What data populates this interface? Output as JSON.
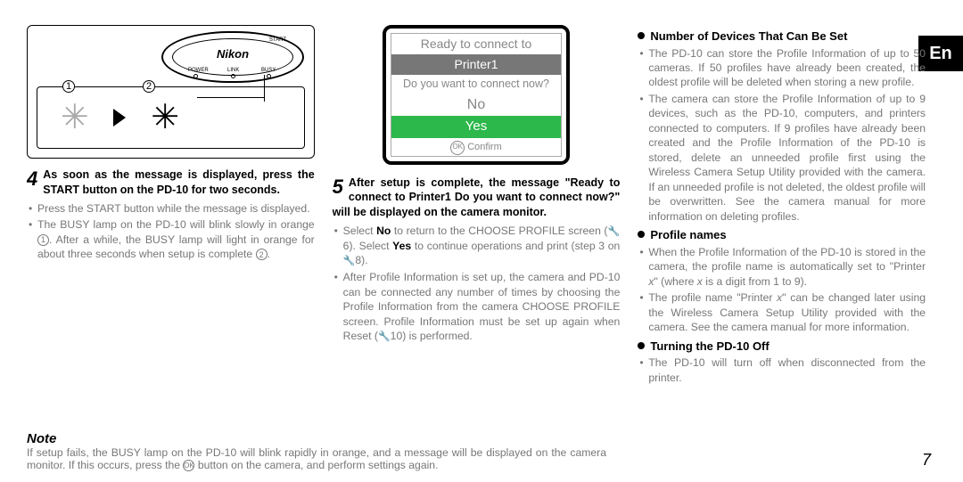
{
  "lang_tab": "En",
  "page_number": "7",
  "illustration": {
    "brand": "Nikon",
    "label_power": "POWER",
    "label_link": "LINK",
    "label_busy": "BUSY",
    "label_start": "START",
    "callout1": "1",
    "callout2": "2"
  },
  "step4": {
    "num": "4",
    "head": "As soon as the message is displayed, press the START button on the PD-10 for two seconds.",
    "b1": "Press the START button while the message is displayed.",
    "b2a": "The BUSY lamp on the PD-10 will blink slowly in orange ",
    "b2b": ". After a while, the BUSY lamp will light in orange for about three seconds when setup is complete ",
    "b2c": "."
  },
  "note": {
    "title": "Note",
    "body_a": "If setup fails, the BUSY lamp on the PD-10 will blink rapidly in orange, and a message will be displayed on the camera monitor. If this occurs, press the ",
    "body_b": " button on the camera, and perform settings again."
  },
  "dialog": {
    "l1": "Ready to connect to",
    "l2": "Printer1",
    "l3": "Do you want to connect now?",
    "l4": "No",
    "l5": "Yes",
    "confirm": "Confirm",
    "ok": "OK"
  },
  "step5": {
    "num": "5",
    "head": "After setup is complete, the message \"Ready to connect to Printer1 Do you want to connect now?\" will be displayed on the camera monitor.",
    "b1a": "Select ",
    "b1b": "No",
    "b1c": " to return to the CHOOSE PROFILE screen (",
    "b1d": "6). Select ",
    "b1e": "Yes",
    "b1f": " to continue operations and print (step 3 on ",
    "b1g": "8).",
    "b2a": "After Profile Information is set up, the camera and PD-10 can be connected any number of times by choosing the Profile Information from the camera CHOOSE PROFILE screen. Profile Information must be set up again when Reset (",
    "b2b": "10) is performed."
  },
  "sec1": {
    "head": "Number of Devices That Can Be Set",
    "b1": "The PD-10 can store the Profile Information of up to 50 cameras. If 50 profiles have already been created, the oldest profile will be deleted when storing a new profile.",
    "b2": "The camera can store the Profile Information of up to 9 devices, such as the PD-10, computers, and printers connected to computers. If 9 profiles have already been created and the Profile Information of the PD-10 is stored, delete an unneeded profile first using the Wireless Camera Setup Utility provided with the camera. If an unneeded profile is not deleted, the oldest profile will be overwritten. See the camera manual for more information on deleting profiles."
  },
  "sec2": {
    "head": "Profile names",
    "b1a": "When the Profile Information of the PD-10 is stored in the camera, the profile name is automatically set to \"Printer ",
    "b1b": "x",
    "b1c": "\" (where ",
    "b1d": "x",
    "b1e": " is a digit from 1 to 9).",
    "b2a": "The profile name \"Printer ",
    "b2b": "x",
    "b2c": "\" can be changed later using the Wireless Camera Setup Utility provided with the camera. See the camera manual for more information."
  },
  "sec3": {
    "head": "Turning the PD-10 Off",
    "b1": "The PD-10 will turn off when disconnected from the printer."
  }
}
